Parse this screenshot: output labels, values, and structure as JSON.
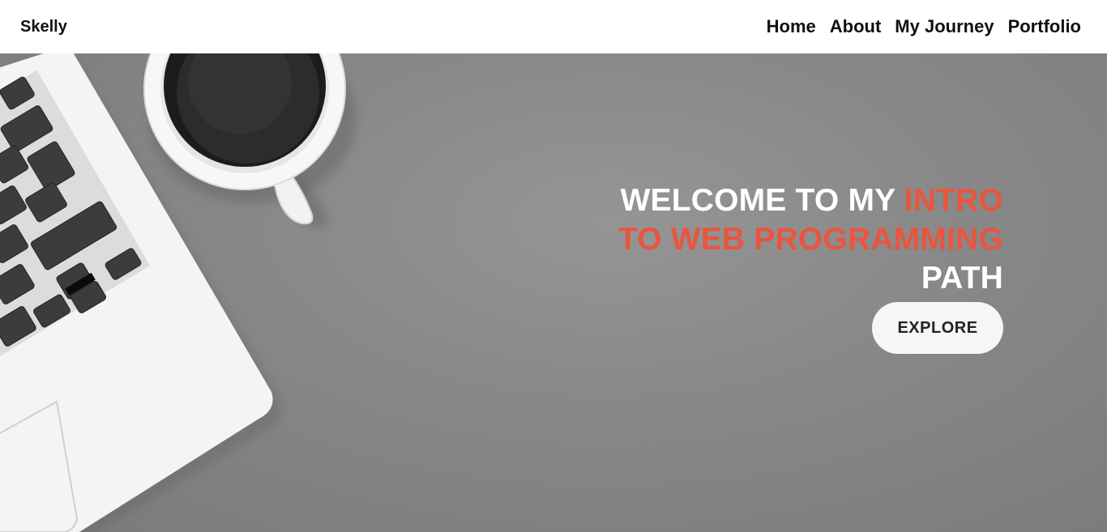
{
  "navbar": {
    "brand": "Skelly",
    "links": [
      "Home",
      "About",
      "My Journey",
      "Portfolio"
    ]
  },
  "hero": {
    "heading_part1": "WELCOME TO MY ",
    "heading_accent": "INTRO TO WEB PROGRAMMING",
    "heading_part2": " PATH",
    "button_label": "EXPLORE",
    "accent_color": "#e9553f"
  },
  "image": {
    "icons": [
      "laptop-keyboard-image",
      "coffee-cup-image"
    ]
  }
}
